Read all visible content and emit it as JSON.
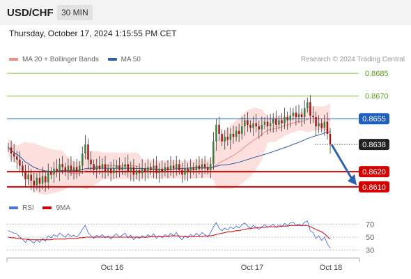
{
  "header": {
    "symbol": "USD/CHF",
    "interval": "30 MIN",
    "timestamp": "Thursday, October 17, 2024 1:15:55 PM CET",
    "credit": "Research © 2024 Trading Central"
  },
  "colors": {
    "bollinger": "#f28b82",
    "bollinger_fill": "#fde0de",
    "ma50": "#2e5ea8",
    "resistance": "#8bc34a",
    "pivot": "#1f5fbf",
    "support": "#d50000",
    "last_price_badge": "#222222",
    "rsi": "#4a73d9",
    "rsi_ma": "#d50000",
    "arrow": "#2d62b0"
  },
  "chart_data": [
    {
      "type": "candlestick",
      "title": "",
      "legend": [
        {
          "name": "MA 20 + Bollinger Bands",
          "color": "#f28b82"
        },
        {
          "name": "MA 50",
          "color": "#2e5ea8"
        }
      ],
      "legend_position": "top-left",
      "x_ticks": [
        "Oct 16",
        "Oct 17",
        "Oct 18"
      ],
      "ylim": [
        0.8603,
        0.8692
      ],
      "levels": [
        {
          "value": 0.8685,
          "label": "0.8685",
          "kind": "resistance"
        },
        {
          "value": 0.867,
          "label": "0.8670",
          "kind": "resistance"
        },
        {
          "value": 0.8655,
          "label": "0.8655",
          "kind": "pivot"
        },
        {
          "value": 0.8638,
          "label": "0.8638",
          "kind": "last"
        },
        {
          "value": 0.862,
          "label": "0.8620",
          "kind": "support"
        },
        {
          "value": 0.861,
          "label": "0.8610",
          "kind": "support"
        }
      ],
      "close_series": [
        0.8636,
        0.8632,
        0.863,
        0.8628,
        0.8624,
        0.862,
        0.8615,
        0.8618,
        0.8614,
        0.8611,
        0.8616,
        0.8612,
        0.8617,
        0.8613,
        0.862,
        0.8618,
        0.8622,
        0.862,
        0.8625,
        0.8623,
        0.862,
        0.8624,
        0.8621,
        0.8623,
        0.862,
        0.8624,
        0.8632,
        0.8638,
        0.8628,
        0.8625,
        0.8621,
        0.8624,
        0.8622,
        0.8625,
        0.862,
        0.8622,
        0.8619,
        0.8622,
        0.8624,
        0.8621,
        0.8623,
        0.8625,
        0.862,
        0.8623,
        0.8618,
        0.8621,
        0.8619,
        0.8622,
        0.862,
        0.8623,
        0.8621,
        0.8624,
        0.8619,
        0.8622,
        0.862,
        0.8623,
        0.8621,
        0.8624,
        0.8622,
        0.8625,
        0.8621,
        0.8618,
        0.8622,
        0.862,
        0.8623,
        0.8621,
        0.8624,
        0.8622,
        0.8625,
        0.8623,
        0.8621,
        0.8625,
        0.864,
        0.8651,
        0.8645,
        0.864,
        0.8643,
        0.8641,
        0.8645,
        0.8643,
        0.8647,
        0.8645,
        0.865,
        0.8654,
        0.8651,
        0.8649,
        0.8652,
        0.865,
        0.8648,
        0.8651,
        0.8653,
        0.865,
        0.8652,
        0.8655,
        0.8651,
        0.8654,
        0.8652,
        0.8656,
        0.8654,
        0.8657,
        0.8659,
        0.8656,
        0.8658,
        0.8656,
        0.8662,
        0.8666,
        0.8657,
        0.8656,
        0.865,
        0.8652,
        0.8649,
        0.8653,
        0.8645,
        0.8638
      ],
      "rsi_sub_chart": {
        "legend": [
          {
            "name": "RSI",
            "color": "#4a73d9"
          },
          {
            "name": "9MA",
            "color": "#d50000"
          }
        ],
        "y_ticks": [
          70,
          50,
          30
        ],
        "ylim": [
          20,
          80
        ],
        "rsi": [
          60,
          58,
          56,
          55,
          50,
          47,
          42,
          48,
          44,
          41,
          46,
          42,
          48,
          44,
          52,
          49,
          54,
          51,
          56,
          53,
          50,
          55,
          51,
          53,
          50,
          55,
          62,
          68,
          57,
          52,
          48,
          53,
          50,
          54,
          49,
          52,
          47,
          52,
          55,
          50,
          53,
          56,
          49,
          53,
          46,
          51,
          48,
          52,
          49,
          54,
          50,
          55,
          48,
          52,
          49,
          54,
          51,
          56,
          52,
          57,
          50,
          46,
          52,
          49,
          54,
          51,
          56,
          52,
          57,
          54,
          50,
          57,
          66,
          72,
          64,
          60,
          64,
          61,
          66,
          63,
          67,
          64,
          69,
          72,
          67,
          64,
          68,
          65,
          62,
          66,
          69,
          65,
          67,
          70,
          65,
          69,
          66,
          71,
          68,
          72,
          73,
          68,
          70,
          67,
          73,
          75,
          60,
          57,
          48,
          52,
          45,
          50,
          40,
          33
        ],
        "ma9": [
          50,
          49,
          49,
          48,
          48,
          47,
          47,
          46,
          46,
          46,
          46,
          46,
          46,
          46,
          46,
          46,
          47,
          47,
          47,
          47,
          47,
          48,
          48,
          48,
          48,
          49,
          49,
          50,
          50,
          50,
          50,
          50,
          50,
          50,
          50,
          50,
          50,
          50,
          50,
          50,
          50,
          50,
          50,
          50,
          50,
          50,
          50,
          50,
          50,
          50,
          51,
          51,
          51,
          51,
          51,
          51,
          51,
          52,
          52,
          52,
          52,
          51,
          51,
          51,
          51,
          51,
          51,
          51,
          51,
          52,
          52,
          52,
          53,
          54,
          55,
          56,
          57,
          58,
          58,
          59,
          60,
          60,
          61,
          62,
          63,
          63,
          64,
          64,
          65,
          65,
          65,
          66,
          66,
          66,
          66,
          66,
          67,
          67,
          67,
          68,
          68,
          68,
          68,
          68,
          68,
          68,
          66,
          64,
          62,
          60,
          58,
          55,
          51,
          47
        ]
      }
    }
  ]
}
